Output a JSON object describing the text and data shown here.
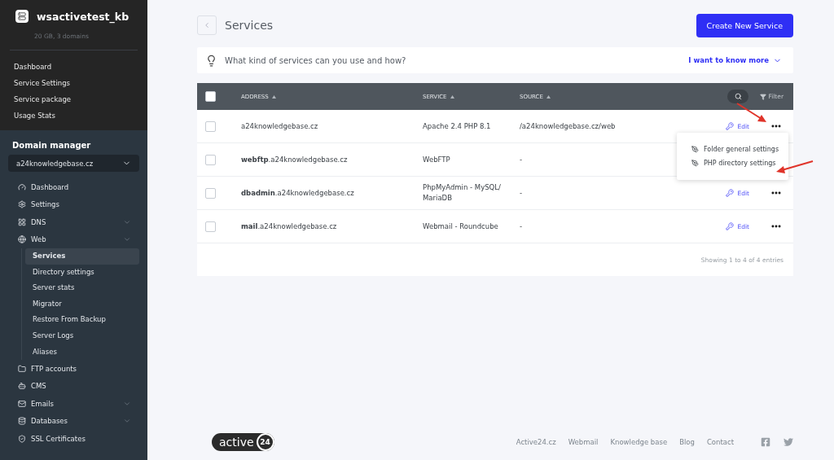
{
  "account": {
    "name": "wsactivetest_kb",
    "subtitle": "20 GB, 3 domains"
  },
  "account_menu": [
    "Dashboard",
    "Service Settings",
    "Service package",
    "Usage Stats"
  ],
  "domain_manager": {
    "title": "Domain manager",
    "domain": "a24knowledgebase.cz"
  },
  "nav": [
    {
      "label": "Dashboard",
      "expandable": false
    },
    {
      "label": "Settings",
      "expandable": false
    },
    {
      "label": "DNS",
      "expandable": true
    },
    {
      "label": "Web",
      "expandable": true,
      "children": [
        {
          "label": "Services",
          "selected": true
        },
        {
          "label": "Directory settings",
          "selected": false
        },
        {
          "label": "Server stats",
          "selected": false
        },
        {
          "label": "Migrator",
          "selected": false
        },
        {
          "label": "Restore From Backup",
          "selected": false
        },
        {
          "label": "Server Logs",
          "selected": false
        },
        {
          "label": "Aliases",
          "selected": false
        }
      ]
    },
    {
      "label": "FTP accounts",
      "expandable": false
    },
    {
      "label": "CMS",
      "expandable": false
    },
    {
      "label": "Emails",
      "expandable": true
    },
    {
      "label": "Databases",
      "expandable": true
    },
    {
      "label": "SSL Certificates",
      "expandable": false
    }
  ],
  "header": {
    "title": "Services",
    "button": "Create New Service"
  },
  "tip": {
    "text": "What kind of services can you use and how?",
    "link": "I want to know more"
  },
  "table": {
    "checked": false,
    "columns": [
      "ADDRESS",
      "SERVICE",
      "SOURCE"
    ],
    "filter": "Filter",
    "rows": [
      {
        "address": "a24knowledgebase.cz",
        "service": "Apache 2.4 PHP 8.1",
        "source": "/a24knowledgebase.cz/web",
        "action": "Edit",
        "checked": false
      },
      {
        "address": "**webftp**.a24knowledgebase.cz",
        "service": "WebFTP",
        "source": "-",
        "checked": false
      },
      {
        "address": "**dbadmin**.a24knowledgebase.cz",
        "service": "PhpMyAdmin - MySQL/ MariaDB",
        "source": "-",
        "action": "Edit",
        "checked": false
      },
      {
        "address": "**mail**.a24knowledgebase.cz",
        "service": "Webmail - Roundcube",
        "source": "-",
        "action": "Edit",
        "checked": false
      }
    ],
    "info": "Showing 1 to 4 of 4 entries"
  },
  "menu": {
    "items": [
      "Folder general settings",
      "PHP directory settings"
    ]
  },
  "footer": {
    "logo_text": "active",
    "logo_number": "24",
    "links": [
      "Active24.cz",
      "Webmail",
      "Knowledge base",
      "Blog",
      "Contact"
    ]
  }
}
